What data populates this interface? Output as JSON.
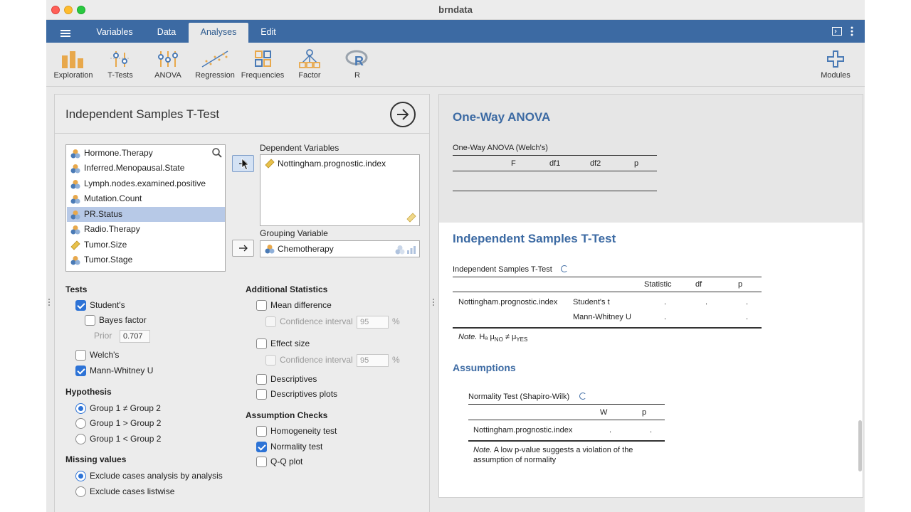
{
  "window": {
    "title": "brndata"
  },
  "menu": {
    "tabs": [
      {
        "label": "Variables"
      },
      {
        "label": "Data"
      },
      {
        "label": "Analyses"
      },
      {
        "label": "Edit"
      }
    ],
    "active_tab": "Analyses"
  },
  "ribbon": {
    "items": [
      {
        "label": "Exploration",
        "icon": "exploration-bars-icon"
      },
      {
        "label": "T-Tests",
        "icon": "t-tests-icon"
      },
      {
        "label": "ANOVA",
        "icon": "anova-icon"
      },
      {
        "label": "Regression",
        "icon": "regression-icon"
      },
      {
        "label": "Frequencies",
        "icon": "frequencies-icon"
      },
      {
        "label": "Factor",
        "icon": "factor-icon"
      },
      {
        "label": "R",
        "icon": "r-logo-icon"
      }
    ],
    "modules_label": "Modules"
  },
  "options": {
    "title": "Independent Samples T-Test",
    "variables": [
      {
        "name": "Hormone.Therapy",
        "type": "nominal",
        "selected": false
      },
      {
        "name": "Inferred.Menopausal.State",
        "type": "nominal",
        "selected": false
      },
      {
        "name": "Lymph.nodes.examined.positive",
        "type": "nominal",
        "selected": false
      },
      {
        "name": "Mutation.Count",
        "type": "nominal",
        "selected": false
      },
      {
        "name": "PR.Status",
        "type": "nominal",
        "selected": true
      },
      {
        "name": "Radio.Therapy",
        "type": "nominal",
        "selected": false
      },
      {
        "name": "Tumor.Size",
        "type": "continuous",
        "selected": false
      },
      {
        "name": "Tumor.Stage",
        "type": "nominal",
        "selected": false
      }
    ],
    "dependent_label": "Dependent Variables",
    "dependent_value": "Nottingham.prognostic.index",
    "grouping_label": "Grouping Variable",
    "grouping_value": "Chemotherapy",
    "tests": {
      "heading": "Tests",
      "students": {
        "label": "Student's",
        "checked": true
      },
      "bayes": {
        "label": "Bayes factor",
        "checked": false
      },
      "prior_label": "Prior",
      "prior_value": "0.707",
      "welch": {
        "label": "Welch's",
        "checked": false
      },
      "mann": {
        "label": "Mann-Whitney U",
        "checked": true
      }
    },
    "hypothesis": {
      "heading": "Hypothesis",
      "options": [
        {
          "label": "Group 1 ≠ Group 2",
          "checked": true
        },
        {
          "label": "Group 1 > Group 2",
          "checked": false
        },
        {
          "label": "Group 1 < Group 2",
          "checked": false
        }
      ]
    },
    "missing": {
      "heading": "Missing values",
      "options": [
        {
          "label": "Exclude cases analysis by analysis",
          "checked": true
        },
        {
          "label": "Exclude cases listwise",
          "checked": false
        }
      ]
    },
    "additional": {
      "heading": "Additional Statistics",
      "mean_difference": "Mean difference",
      "ci_label": "Confidence interval",
      "ci_value": "95",
      "ci_unit": "%",
      "effect_size": "Effect size",
      "es_ci_label": "Confidence interval",
      "es_ci_value": "95",
      "es_ci_unit": "%",
      "descriptives": "Descriptives",
      "descriptives_plots": "Descriptives plots"
    },
    "assumption_checks": {
      "heading": "Assumption Checks",
      "homogeneity": {
        "label": "Homogeneity test",
        "checked": false
      },
      "normality": {
        "label": "Normality test",
        "checked": true
      },
      "qq": {
        "label": "Q-Q plot",
        "checked": false
      }
    }
  },
  "results": {
    "anova": {
      "heading": "One-Way ANOVA",
      "table_title": "One-Way ANOVA (Welch's)",
      "columns": [
        "F",
        "df1",
        "df2",
        "p"
      ]
    },
    "ttest": {
      "heading": "Independent Samples T-Test",
      "table_title": "Independent Samples T-Test",
      "columns": [
        "Statistic",
        "df",
        "p"
      ],
      "row_variable": "Nottingham.prognostic.index",
      "rows": [
        {
          "test": "Student's t",
          "statistic": ".",
          "df": ".",
          "p": "."
        },
        {
          "test": "Mann-Whitney U",
          "statistic": ".",
          "df": "",
          "p": "."
        }
      ],
      "note_label": "Note.",
      "note_text": "Hₐ μ",
      "note_sub1": "NO",
      "note_mid": " ≠ μ",
      "note_sub2": "YES"
    },
    "assumptions": {
      "heading": "Assumptions",
      "table_title": "Normality Test (Shapiro-Wilk)",
      "columns": [
        "W",
        "p"
      ],
      "row_variable": "Nottingham.prognostic.index",
      "w": ".",
      "p": ".",
      "note_label": "Note.",
      "note_line1": "A low p-value suggests a violation of the",
      "note_line2": "assumption of normality"
    }
  }
}
